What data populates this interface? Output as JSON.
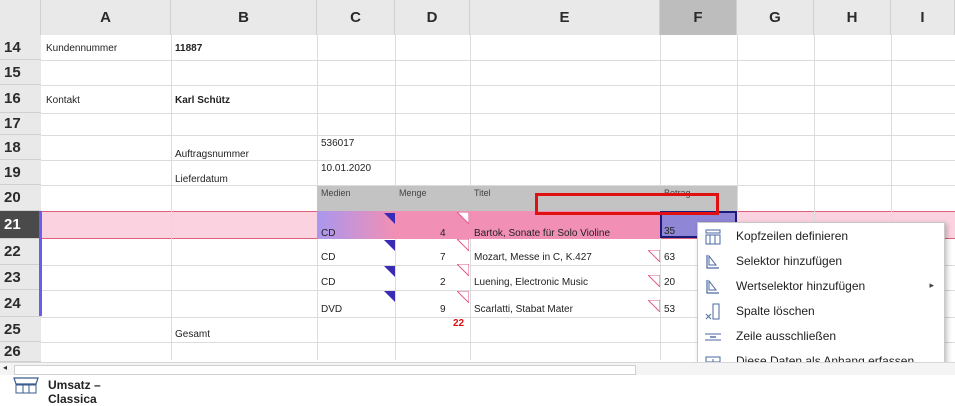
{
  "columns": [
    "A",
    "B",
    "C",
    "D",
    "E",
    "F",
    "G",
    "H",
    "I"
  ],
  "rows": [
    "14",
    "15",
    "16",
    "17",
    "18",
    "19",
    "20",
    "21",
    "22",
    "23",
    "24",
    "25",
    "26"
  ],
  "cells": {
    "kundennummer_label": "Kundennummer",
    "kundennummer_value": "11887",
    "kontakt_label": "Kontakt",
    "kontakt_value": "Karl Schütz",
    "auftragsnummer_label": "Auftragsnummer",
    "auftragsnummer_value": "536017",
    "lieferdatum_label": "Lieferdatum",
    "lieferdatum_value": "10.01.2020",
    "gesamt_label": "Gesamt",
    "gesamt_value": "22"
  },
  "table": {
    "headers": [
      "Medien",
      "Menge",
      "Titel",
      "Betrag"
    ],
    "rows": [
      {
        "medien": "CD",
        "menge": "4",
        "titel": "Bartok, Sonate für Solo Violine",
        "betrag": "35"
      },
      {
        "medien": "CD",
        "menge": "7",
        "titel": "Mozart, Messe in C, K.427",
        "betrag": "63"
      },
      {
        "medien": "CD",
        "menge": "2",
        "titel": "Luening, Electronic Music",
        "betrag": "20"
      },
      {
        "medien": "DVD",
        "menge": "9",
        "titel": "Scarlatti, Stabat Mater",
        "betrag": "53"
      }
    ]
  },
  "context_menu": {
    "items": [
      {
        "label": "Kopfzeilen definieren",
        "icon": "header-rows-icon"
      },
      {
        "label": "Selektor hinzufügen",
        "icon": "selector-icon"
      },
      {
        "label": "Wertselektor hinzufügen",
        "icon": "value-selector-icon",
        "submenu": true
      },
      {
        "label": "Spalte löschen",
        "icon": "delete-column-icon"
      },
      {
        "label": "Zeile ausschließen",
        "icon": "exclude-row-icon"
      },
      {
        "label": "Diese Daten als Anhang erfassen",
        "icon": "attachment-icon"
      }
    ],
    "submenu_arrow": "▸"
  },
  "sheet_tab": {
    "label": "Umsatz – Classica",
    "icon": "sheet-table-icon"
  },
  "scroll_left_arrow": "◂",
  "colors": {
    "selection_pink": "#fbd3e0",
    "band_pink": "#f28fb4",
    "purple": "#6b5cf0",
    "highlight_red": "#e01010",
    "total_red": "#e01010"
  }
}
